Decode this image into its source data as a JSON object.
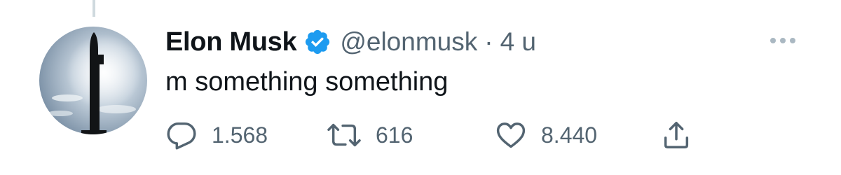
{
  "tweet": {
    "author_name": "Elon Musk",
    "handle": "@elonmusk",
    "separator": "·",
    "time": "4 u",
    "text": "m something something",
    "replies": "1.568",
    "retweets": "616",
    "likes": "8.440"
  },
  "icons": {
    "verified": "verified-badge-icon",
    "more": "more-options-icon",
    "reply": "reply-icon",
    "retweet": "retweet-icon",
    "like": "heart-icon",
    "share": "share-icon"
  },
  "colors": {
    "text": "#0f1419",
    "secondary": "#536471",
    "verified": "#1d9bf0",
    "thread_line": "#cfd9de"
  }
}
